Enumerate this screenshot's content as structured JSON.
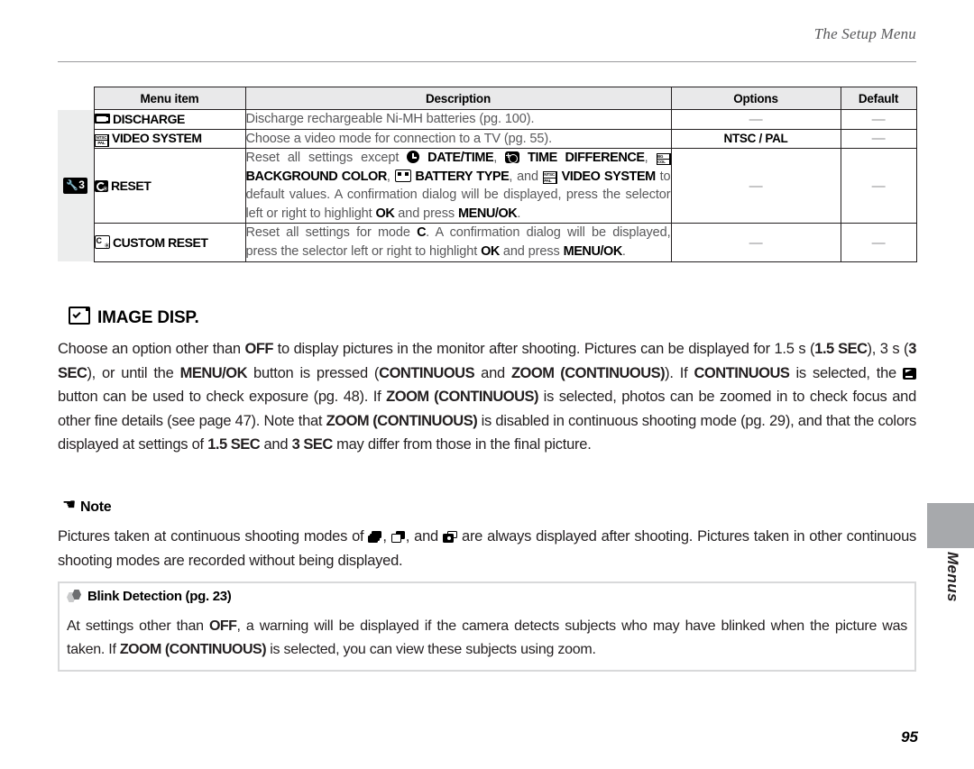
{
  "header": {
    "running_head": "The Setup Menu"
  },
  "table": {
    "columns": [
      "Menu item",
      "Description",
      "Options",
      "Default"
    ],
    "tab_group_label": "3",
    "tab_group_icon": "wrench-icon",
    "rows": [
      {
        "icon": "battery-icon",
        "item": "DISCHARGE",
        "description_plain": "Discharge rechargeable Ni-MH batteries (pg. 100).",
        "options": "—",
        "default": "—"
      },
      {
        "icon": "ntsc-pal-icon",
        "item": "VIDEO SYSTEM",
        "description_plain": "Choose a video mode for connection to a TV (pg. 55).",
        "options": "NTSC / PAL",
        "default": "—"
      },
      {
        "icon": "reset-icon",
        "item": "RESET",
        "description_plain": "Reset all settings except DATE/TIME, TIME DIFFERENCE, BACKGROUND COLOR, BATTERY TYPE, and VIDEO SYSTEM to default values.  A confirmation dialog will be displayed, press the selector left or right to highlight OK and press MENU/OK.",
        "description_parts": [
          {
            "t": "Reset  all  settings  except  ",
            "b": false
          },
          {
            "t": "DATE/TIME",
            "b": true,
            "icon": "clock-icon"
          },
          {
            "t": ",  ",
            "b": false
          },
          {
            "t": "TIME DIFFERENCE",
            "b": true,
            "icon": "time-difference-icon"
          },
          {
            "t": ", ",
            "b": false
          },
          {
            "t": "BACKGROUND COLOR",
            "b": true,
            "icon": "background-color-icon"
          },
          {
            "t": ", ",
            "b": false
          },
          {
            "t": "BATTERY TYPE",
            "b": true,
            "icon": "battery-type-icon"
          },
          {
            "t": ", and ",
            "b": false
          },
          {
            "t": "VIDEO SYSTEM",
            "b": true,
            "icon": "ntsc-pal-icon"
          },
          {
            "t": " to default values.  A confirmation dialog will be displayed, press the selector left or right to highlight ",
            "b": false
          },
          {
            "t": "OK",
            "b": true
          },
          {
            "t": " and press ",
            "b": false
          },
          {
            "t": "MENU/OK",
            "b": true
          },
          {
            "t": ".",
            "b": false
          }
        ],
        "options": "—",
        "default": "—"
      },
      {
        "icon": "custom-reset-icon",
        "item": "CUSTOM RESET",
        "description_plain": "Reset all settings for mode C.  A confirmation dialog will be displayed, press the selector left or right to highlight OK and press MENU/OK.",
        "description_parts": [
          {
            "t": "Reset all settings for mode ",
            "b": false
          },
          {
            "t": "C",
            "b": true
          },
          {
            "t": ".  A confirmation dialog will be displayed, press the selector left or right to highlight ",
            "b": false
          },
          {
            "t": "OK",
            "b": true
          },
          {
            "t": " and press ",
            "b": false
          },
          {
            "t": "MENU/OK",
            "b": true
          },
          {
            "t": ".",
            "b": false
          }
        ],
        "options": "—",
        "default": "—"
      }
    ]
  },
  "section": {
    "icon": "image-disp-icon",
    "title": "IMAGE DISP.",
    "paragraph_plain": "Choose an option other than OFF to display pictures in the monitor after shooting.  Pictures can be displayed for 1.5 s (1.5 SEC), 3 s (3 SEC), or until the MENU/OK button is pressed (CONTINUOUS and ZOOM (CONTINUOUS)).  If CONTINUOUS is selected, the exposure compensation button can be used to check exposure (pg. 48).  If ZOOM (CONTINUOUS) is selected, photos can be zoomed in to check focus and other fine details (see page 47).  Note that ZOOM (CONTINUOUS) is disabled in continuous shooting mode (pg. 29), and that the colors displayed at settings of 1.5 SEC and 3 SEC may differ from those in the final picture.",
    "paragraph_parts": [
      {
        "t": "Choose an option other than ",
        "b": false
      },
      {
        "t": "OFF",
        "b": true
      },
      {
        "t": " to display pictures in the monitor after shooting.  Pictures can be displayed for 1.5 s (",
        "b": false
      },
      {
        "t": "1.5 SEC",
        "b": true
      },
      {
        "t": "), 3 s (",
        "b": false
      },
      {
        "t": "3 SEC",
        "b": true
      },
      {
        "t": "), or until the ",
        "b": false
      },
      {
        "t": "MENU/OK",
        "b": true
      },
      {
        "t": " button is pressed (",
        "b": false
      },
      {
        "t": "CONTINUOUS",
        "b": true
      },
      {
        "t": " and ",
        "b": false
      },
      {
        "t": "ZOOM (CONTINUOUS)",
        "b": true
      },
      {
        "t": ").  If ",
        "b": false
      },
      {
        "t": "CONTINUOUS",
        "b": true
      },
      {
        "t": " is selected, the ",
        "b": false
      },
      {
        "t": "",
        "b": false,
        "icon": "exposure-compensation-icon"
      },
      {
        "t": " button can be used to check exposure (pg. 48).  If ",
        "b": false
      },
      {
        "t": "ZOOM (CONTINUOUS)",
        "b": true
      },
      {
        "t": " is selected, photos can be zoomed in to check focus and other fine details (see page 47).  Note that ",
        "b": false
      },
      {
        "t": "ZOOM (CONTINUOUS)",
        "b": true
      },
      {
        "t": " is disabled in continuous shooting mode (pg. 29), and that the colors displayed at settings of ",
        "b": false
      },
      {
        "t": "1.5 SEC",
        "b": true
      },
      {
        "t": " and ",
        "b": false
      },
      {
        "t": "3 SEC",
        "b": true
      },
      {
        "t": " may differ from those in the final picture.",
        "b": false
      }
    ]
  },
  "note": {
    "icon": "pointing-hand-icon",
    "title": "Note",
    "paragraph_plain": "Pictures taken at continuous shooting modes of (top-burst), (best-frame), and (final-burst) are always displayed after shooting.  Pictures taken in other continuous shooting modes are recorded without being displayed.",
    "paragraph_parts": [
      {
        "t": "Pictures taken at continuous shooting modes of ",
        "b": false
      },
      {
        "t": "",
        "b": false,
        "icon": "burst-stack-icon"
      },
      {
        "t": ", ",
        "b": false
      },
      {
        "t": "",
        "b": false,
        "icon": "burst-frames-icon"
      },
      {
        "t": ", and ",
        "b": false
      },
      {
        "t": "",
        "b": false,
        "icon": "burst-final-icon"
      },
      {
        "t": " are always displayed after shooting.  Pictures taken in other continuous shooting modes are recorded without being displayed.",
        "b": false
      }
    ]
  },
  "blink": {
    "icon": "blink-detection-icon",
    "title": "Blink Detection (pg. 23)",
    "paragraph_plain": "At settings other than OFF, a warning will be displayed if the camera detects subjects who may have blinked when the picture was taken.  If ZOOM (CONTINUOUS) is selected, you can view these subjects using zoom.",
    "paragraph_parts": [
      {
        "t": "At settings other than ",
        "b": false
      },
      {
        "t": "OFF",
        "b": true
      },
      {
        "t": ", a warning will be displayed if the camera detects subjects who may have blinked when the picture was taken.  If ",
        "b": false
      },
      {
        "t": "ZOOM (CONTINUOUS)",
        "b": true
      },
      {
        "t": " is selected, you can view these subjects using zoom.",
        "b": false
      }
    ]
  },
  "sidebar": {
    "label": "Menus"
  },
  "footer": {
    "page_number": "95"
  },
  "colors": {
    "rule": "#9a9a9c",
    "header_fill": "#e9e9ea",
    "tab_fill": "#eceded",
    "side_tab": "#a7a9ac",
    "body_text": "#231f20",
    "muted_text": "#58585a",
    "box_border": "#d8d9da"
  }
}
